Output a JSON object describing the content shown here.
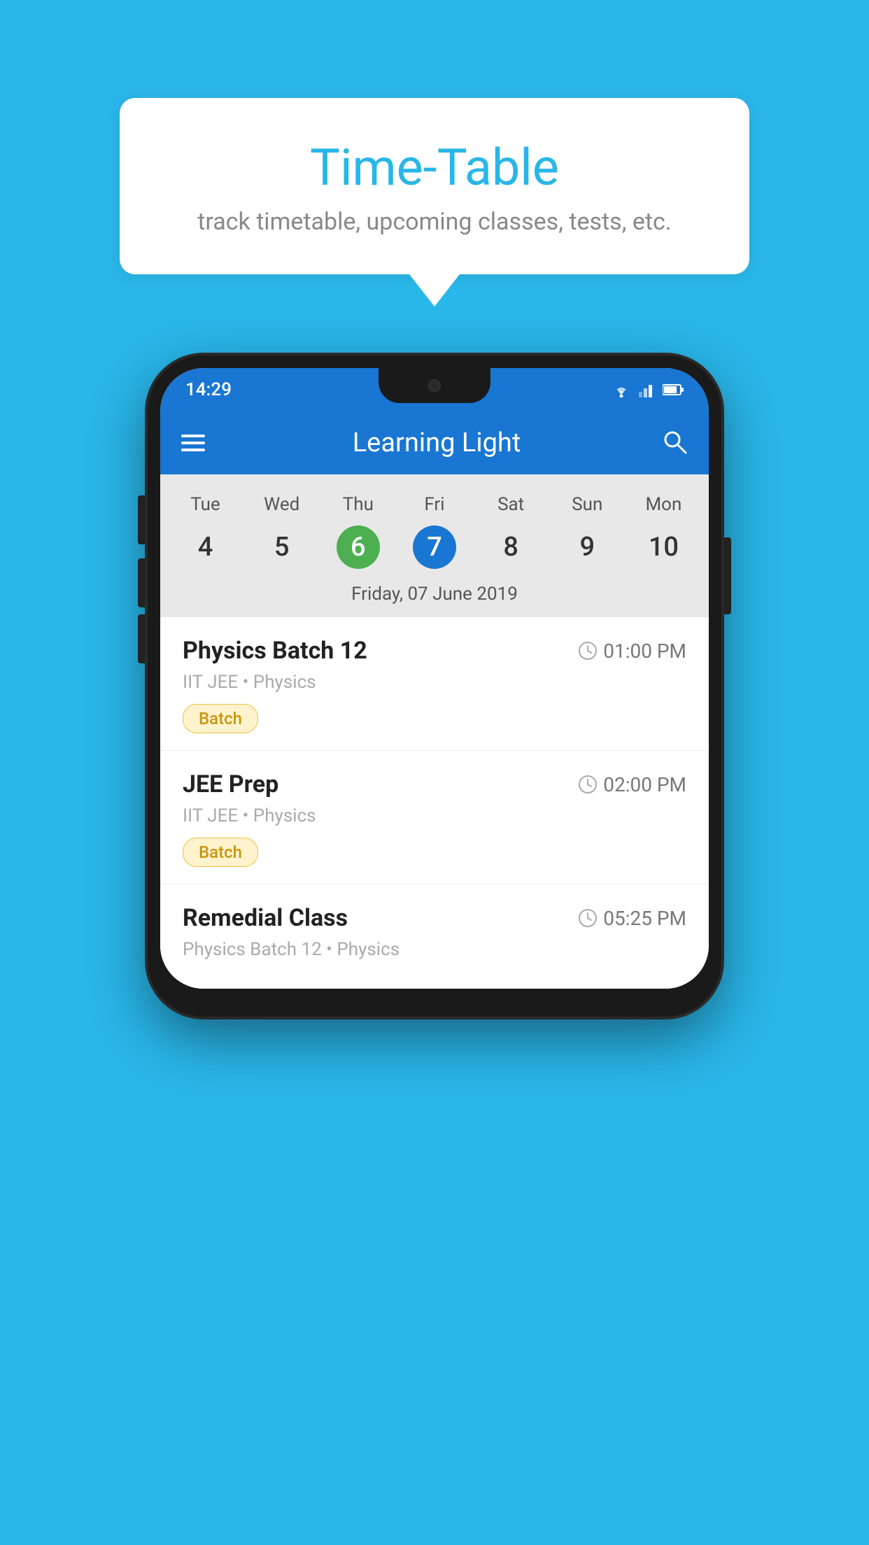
{
  "background_color": "#29B6E8",
  "tooltip": {
    "title": "Time-Table",
    "subtitle": "track timetable, upcoming classes, tests, etc."
  },
  "status_bar": {
    "time": "14:29"
  },
  "app_bar": {
    "title": "Learning Light"
  },
  "calendar": {
    "days": [
      {
        "label": "Tue",
        "num": "4"
      },
      {
        "label": "Wed",
        "num": "5"
      },
      {
        "label": "Thu",
        "num": "6",
        "state": "today"
      },
      {
        "label": "Fri",
        "num": "7",
        "state": "selected"
      },
      {
        "label": "Sat",
        "num": "8"
      },
      {
        "label": "Sun",
        "num": "9"
      },
      {
        "label": "Mon",
        "num": "10"
      }
    ],
    "selected_date": "Friday, 07 June 2019"
  },
  "schedule": {
    "items": [
      {
        "title": "Physics Batch 12",
        "time": "01:00 PM",
        "meta": "IIT JEE • Physics",
        "badge": "Batch"
      },
      {
        "title": "JEE Prep",
        "time": "02:00 PM",
        "meta": "IIT JEE • Physics",
        "badge": "Batch"
      },
      {
        "title": "Remedial Class",
        "time": "05:25 PM",
        "meta": "Physics Batch 12 • Physics",
        "badge": null
      }
    ]
  },
  "icons": {
    "hamburger": "☰",
    "search": "🔍"
  }
}
